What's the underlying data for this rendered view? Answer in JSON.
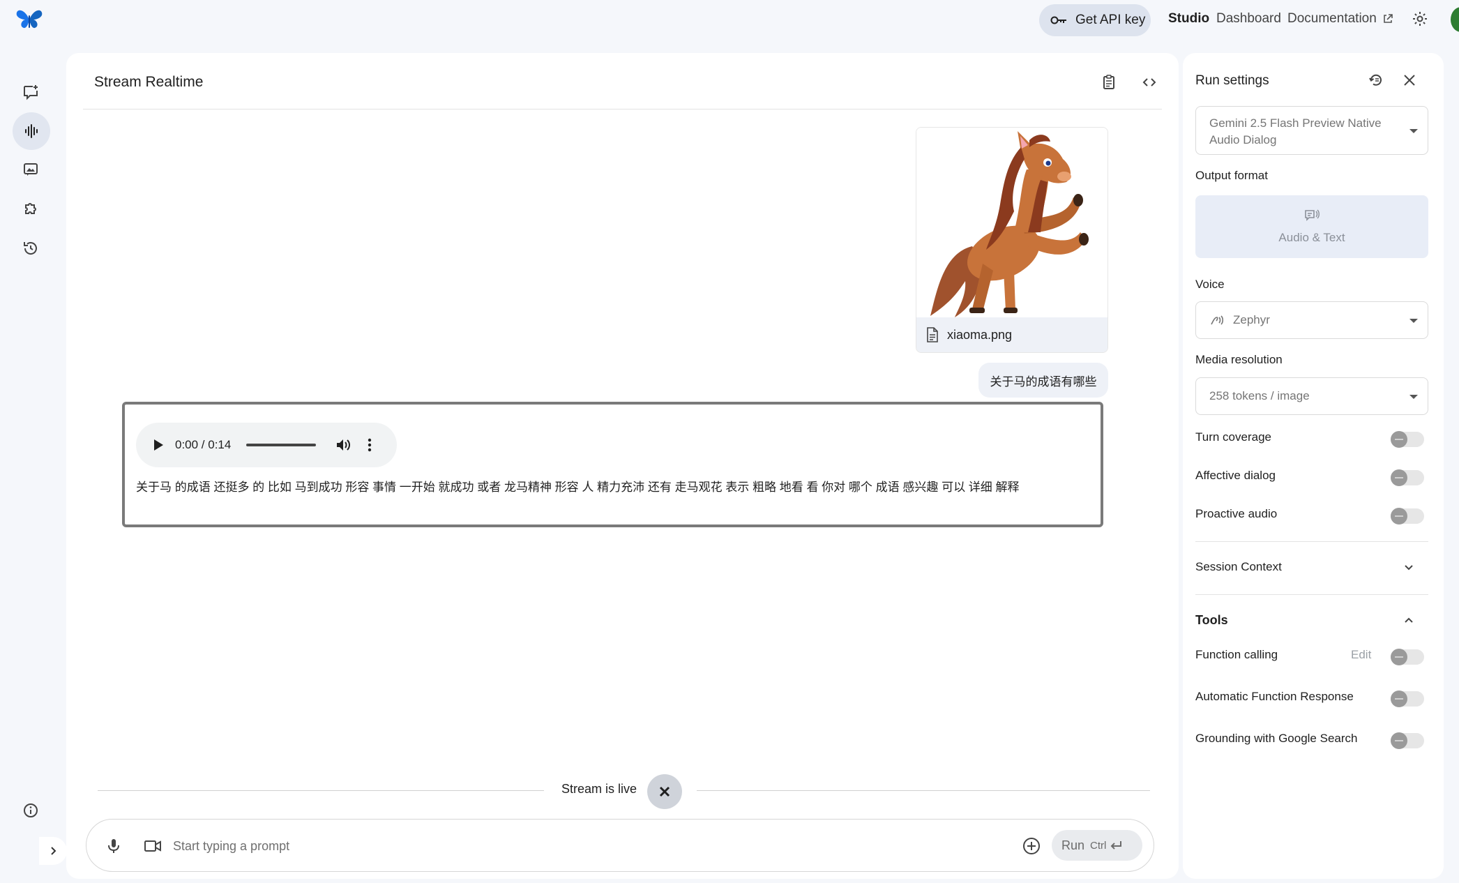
{
  "header": {
    "api_key_label": "Get API key",
    "nav": {
      "studio": "Studio",
      "dashboard": "Dashboard",
      "documentation": "Documentation"
    }
  },
  "main": {
    "title": "Stream Realtime",
    "attachment": {
      "filename": "xiaoma.png"
    },
    "user_message": "关于马的成语有哪些",
    "response": {
      "audio_time": "0:00 / 0:14",
      "text": "关于马 的成语 还挺多 的 比如 马到成功 形容 事情 一开始 就成功 或者 龙马精神 形容 人 精力充沛 还有 走马观花 表示 粗略 地看 看 你对 哪个 成语 感兴趣 可以 详细 解释"
    },
    "stream_status": "Stream is live",
    "prompt": {
      "placeholder": "Start typing a prompt",
      "value": "",
      "run_label": "Run",
      "shortcut": "Ctrl"
    }
  },
  "run_settings": {
    "title": "Run settings",
    "model": "Gemini 2.5 Flash Preview Native Audio Dialog",
    "output_format_label": "Output format",
    "output_format_value": "Audio & Text",
    "voice_label": "Voice",
    "voice_value": "Zephyr",
    "media_resolution_label": "Media resolution",
    "media_resolution_value": "258 tokens / image",
    "toggles": {
      "turn_coverage": {
        "label": "Turn coverage",
        "on": false
      },
      "affective_dialog": {
        "label": "Affective dialog",
        "on": false
      },
      "proactive_audio": {
        "label": "Proactive audio",
        "on": false
      }
    },
    "session_context_label": "Session Context",
    "tools": {
      "title": "Tools",
      "function_calling": {
        "label": "Function calling",
        "edit": "Edit",
        "on": false
      },
      "automatic_function_response": {
        "label": "Automatic Function Response",
        "on": false
      },
      "grounding_google_search": {
        "label": "Grounding with Google Search",
        "on": false
      }
    }
  },
  "colors": {
    "accent_blue": "#1a73e8",
    "panel_bg": "#ffffff",
    "page_bg": "#f5f7fb",
    "pill_bg": "#dde3ee"
  }
}
